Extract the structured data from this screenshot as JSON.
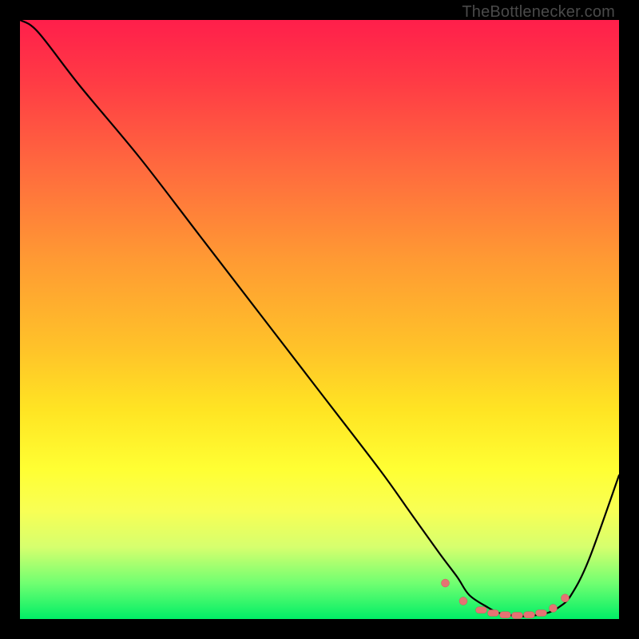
{
  "watermark": "TheBottlenecker.com",
  "chart_data": {
    "type": "line",
    "title": "",
    "xlabel": "",
    "ylabel": "",
    "xlim": [
      0,
      100
    ],
    "ylim": [
      0,
      100
    ],
    "series": [
      {
        "name": "bottleneck-curve",
        "x": [
          0,
          3,
          10,
          20,
          30,
          40,
          50,
          60,
          65,
          70,
          73,
          75,
          78,
          80,
          83,
          85,
          88,
          90,
          92,
          95,
          100
        ],
        "y": [
          100,
          98,
          89,
          77,
          64,
          51,
          38,
          25,
          18,
          11,
          7,
          4,
          2,
          1,
          0.5,
          0.5,
          1,
          2,
          4,
          10,
          24
        ]
      }
    ],
    "markers": {
      "x": [
        71,
        74,
        77,
        79,
        81,
        83,
        85,
        87,
        89,
        91
      ],
      "y": [
        6,
        3,
        1.5,
        1,
        0.7,
        0.6,
        0.7,
        1,
        1.8,
        3.5
      ]
    },
    "marker_color": "#e57373",
    "background_gradient": [
      "#ff1f4b",
      "#ff6b3e",
      "#ffc329",
      "#ffff33",
      "#00ee66"
    ]
  }
}
